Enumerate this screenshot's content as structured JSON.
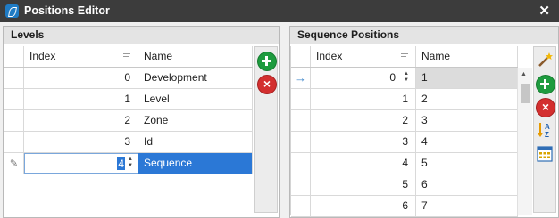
{
  "window": {
    "title": "Positions Editor",
    "close_glyph": "✕"
  },
  "levels": {
    "header": "Levels",
    "columns": [
      "Index",
      "Name"
    ],
    "rows": [
      {
        "index": "0",
        "name": "Development"
      },
      {
        "index": "1",
        "name": "Level"
      },
      {
        "index": "2",
        "name": "Zone"
      },
      {
        "index": "3",
        "name": "Id"
      }
    ],
    "editing_row": {
      "index": "4",
      "name": "Sequence"
    },
    "toolbar": [
      "add-icon",
      "delete-icon"
    ]
  },
  "sequence": {
    "header": "Sequence Positions",
    "columns": [
      "Index",
      "Name"
    ],
    "current_row_indicator": "→",
    "rows": [
      {
        "index": "0",
        "name": "1"
      },
      {
        "index": "1",
        "name": "2"
      },
      {
        "index": "2",
        "name": "3"
      },
      {
        "index": "3",
        "name": "4"
      },
      {
        "index": "4",
        "name": "5"
      },
      {
        "index": "5",
        "name": "6"
      },
      {
        "index": "6",
        "name": "7"
      }
    ],
    "toolbar": [
      "magic-wand-icon",
      "add-icon",
      "delete-icon",
      "sort-az-icon",
      "calculator-grid-icon"
    ]
  },
  "colors": {
    "selection": "#2b78d6",
    "add": "#1e9b3f",
    "delete": "#d32f2f",
    "titlebar": "#3c3c3c"
  }
}
